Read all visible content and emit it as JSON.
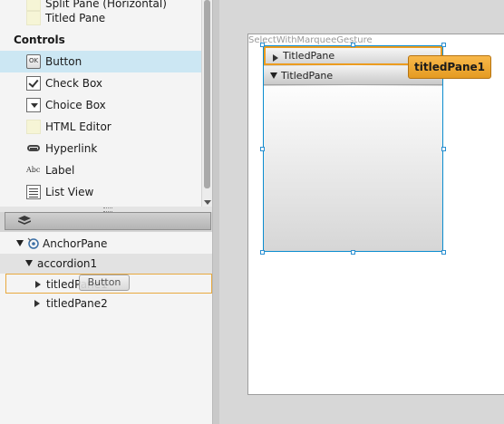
{
  "library": {
    "top_partial_item": "Split Pane (Horizontal)",
    "titled_pane_label": "Titled Pane",
    "section_controls": "Controls",
    "items": [
      {
        "label": "Button",
        "icon": "button-icon",
        "selected": true
      },
      {
        "label": "Check Box",
        "icon": "checkbox-icon"
      },
      {
        "label": "Choice Box",
        "icon": "choicebox-icon"
      },
      {
        "label": "HTML Editor",
        "icon": "html-editor-icon"
      },
      {
        "label": "Hyperlink",
        "icon": "hyperlink-icon"
      },
      {
        "label": "Label",
        "icon": "label-icon"
      },
      {
        "label": "List View",
        "icon": "listview-icon"
      }
    ],
    "button_icon_text": "OK",
    "label_icon_text": "Abc"
  },
  "hierarchy": {
    "rows": [
      {
        "label": "AnchorPane"
      },
      {
        "label": "accordion1"
      },
      {
        "label": "titledPane1"
      },
      {
        "label": "titledPane2"
      }
    ],
    "drag_ghost": "Button"
  },
  "canvas": {
    "gesture_label": "SelectWithMarqueeGesture",
    "pane1_label": "TitledPane",
    "pane2_label": "TitledPane",
    "tooltip": "titledPane1"
  },
  "colors": {
    "selection": "#cce7f3",
    "accent_orange": "#ec9c1f",
    "selection_blue": "#0a8ccf"
  }
}
